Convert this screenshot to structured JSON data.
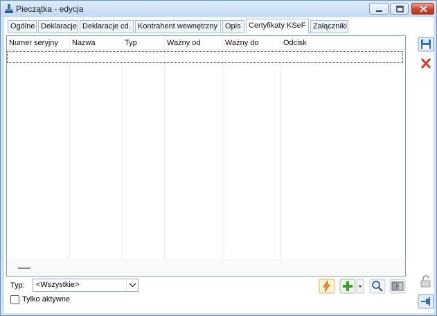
{
  "window": {
    "title": "Pieczątka - edycja"
  },
  "tabs": [
    {
      "label": "Ogólne",
      "active": false
    },
    {
      "label": "Deklaracje",
      "active": false
    },
    {
      "label": "Deklaracje cd.",
      "active": false
    },
    {
      "label": "Kontrahent wewnętrzny",
      "active": false
    },
    {
      "label": "Opis",
      "active": false
    },
    {
      "label": "Certyfikaty KSeF",
      "active": true
    },
    {
      "label": "Załączniki",
      "active": false
    }
  ],
  "grid": {
    "columns": [
      "Numer seryjny",
      "Nazwa",
      "Typ",
      "Ważny od",
      "Ważny do",
      "Odcisk"
    ],
    "rows": []
  },
  "filter": {
    "type_label": "Typ:",
    "type_value": "<Wszystkie>",
    "only_active_label": "Tylko aktywne",
    "only_active_checked": false
  },
  "icons": {
    "save": "save-icon",
    "cancel": "close-icon",
    "lock": "lock-open-icon",
    "pin": "pin-icon",
    "generate": "lightning-icon",
    "add": "plus-icon",
    "preview": "magnifier-icon",
    "archive": "archive-icon"
  },
  "colors": {
    "accent": "#2f6db5",
    "tab_border": "#9fbddb",
    "cancel_red": "#d9362b",
    "add_green": "#3e9b2e"
  }
}
